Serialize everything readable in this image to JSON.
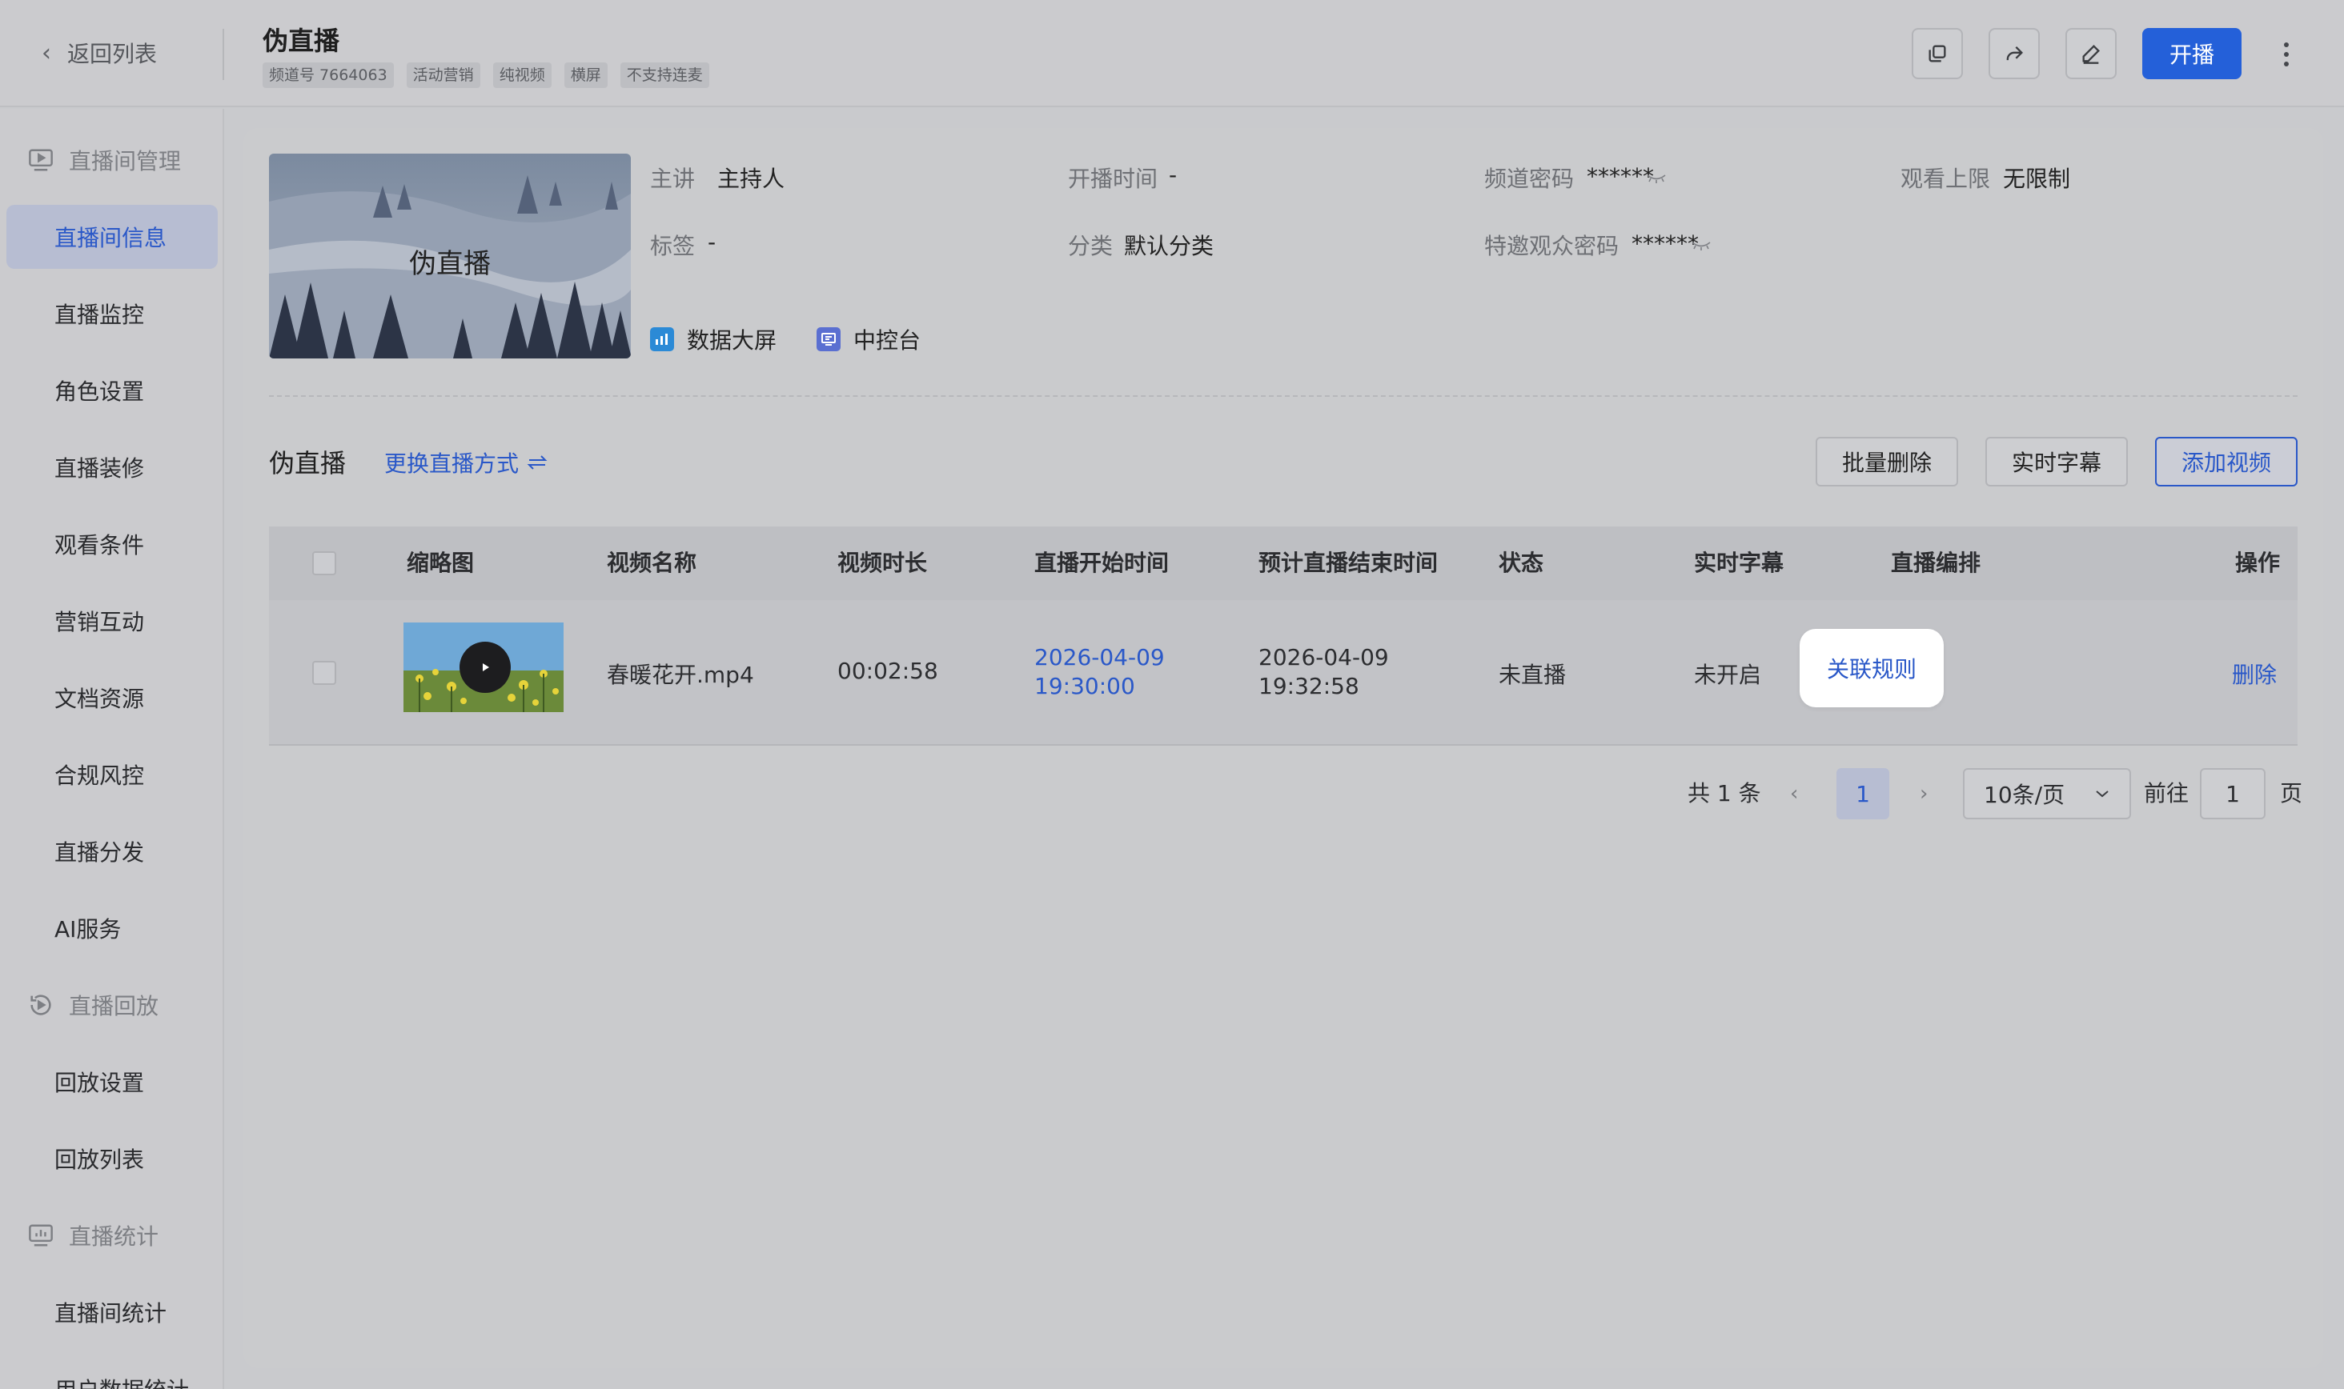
{
  "header": {
    "back_label": "返回列表",
    "title": "伪直播",
    "tags": [
      "频道号 7664063",
      "活动营销",
      "纯视频",
      "横屏",
      "不支持连麦"
    ],
    "live_button": "开播"
  },
  "sidebar": {
    "group_manage": "直播间管理",
    "items_manage": [
      "直播间信息",
      "直播监控",
      "角色设置",
      "直播装修",
      "观看条件",
      "营销互动",
      "文档资源",
      "合规风控",
      "直播分发",
      "AI服务"
    ],
    "group_replay": "直播回放",
    "items_replay": [
      "回放设置",
      "回放列表"
    ],
    "group_stats": "直播统计",
    "items_stats": [
      "直播间统计",
      "用户数据统计"
    ],
    "active": "直播间信息"
  },
  "channel": {
    "cover_title": "伪直播",
    "host_label": "主讲",
    "host_value": "主持人",
    "start_label": "开播时间",
    "start_value": "-",
    "pwd_label": "频道密码",
    "pwd_value": "******",
    "limit_label": "观看上限",
    "limit_value": "无限制",
    "tag_label": "标签",
    "tag_value": "-",
    "category_label": "分类",
    "category_value": "默认分类",
    "guest_pwd_label": "特邀观众密码",
    "guest_pwd_value": "******",
    "quick_links": [
      "数据大屏",
      "中控台"
    ]
  },
  "section": {
    "title": "伪直播",
    "switch_link": "更换直播方式",
    "buttons": [
      "批量删除",
      "实时字幕",
      "添加视频"
    ]
  },
  "table": {
    "headers": [
      "缩略图",
      "视频名称",
      "视频时长",
      "直播开始时间",
      "预计直播结束时间",
      "状态",
      "实时字幕",
      "直播编排",
      "操作"
    ],
    "rows": [
      {
        "name": "春暖花开.mp4",
        "duration": "00:02:58",
        "start_date": "2026-04-09",
        "start_time": "19:30:00",
        "end_date": "2026-04-09",
        "end_time": "19:32:58",
        "status": "未直播",
        "subtitle": "未开启",
        "schedule": "关联规则",
        "action": "删除"
      }
    ]
  },
  "pagination": {
    "total_text": "共 1 条",
    "current": "1",
    "page_size": "10条/页",
    "goto_label": "前往",
    "goto_value": "1",
    "page_suffix": "页"
  },
  "colors": {
    "accent": "#2a58c8",
    "primary_button": "#2460d9",
    "overlay_background": "#c9cacd"
  }
}
